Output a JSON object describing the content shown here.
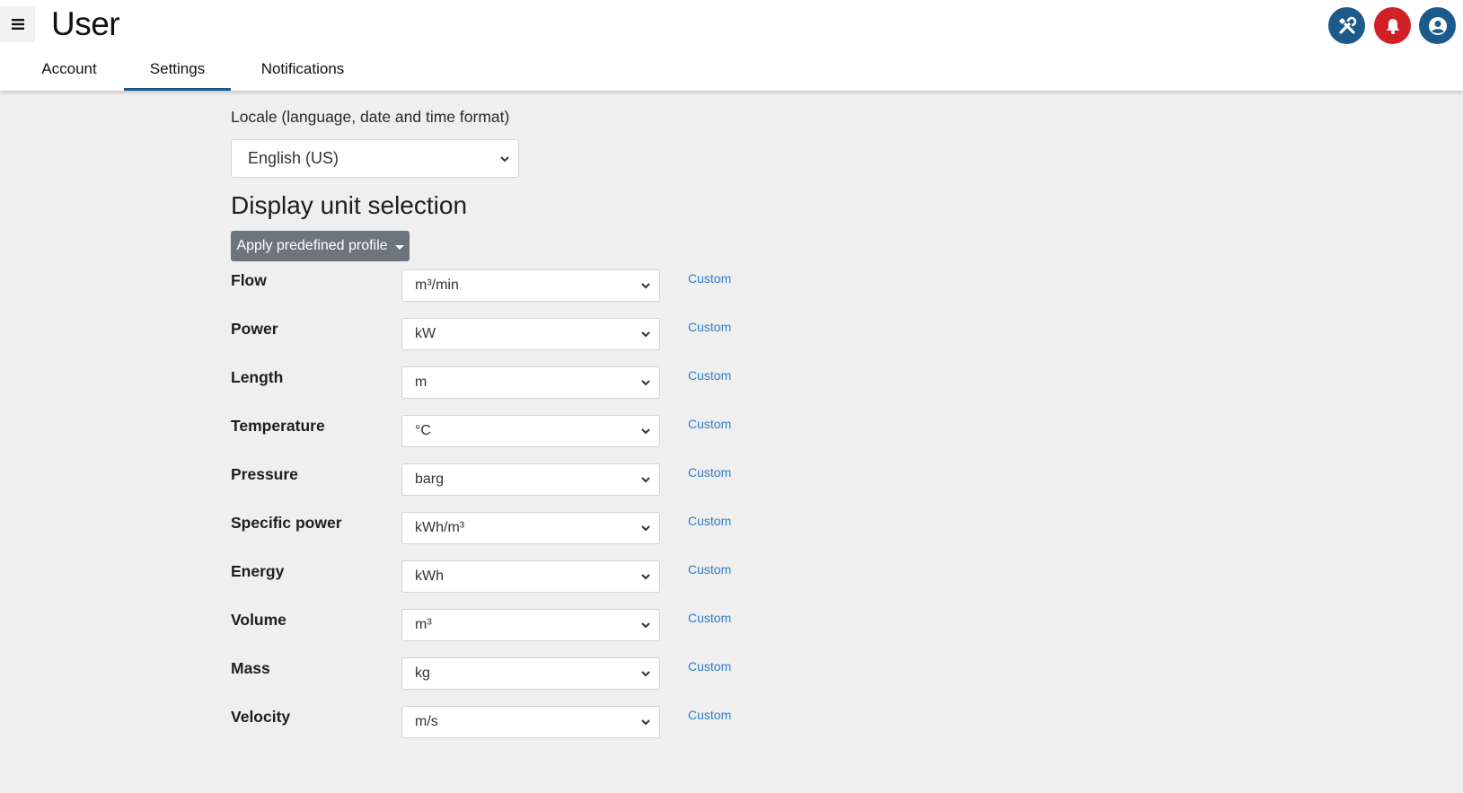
{
  "header": {
    "title": "User",
    "tabs": [
      {
        "label": "Account"
      },
      {
        "label": "Settings"
      },
      {
        "label": "Notifications"
      }
    ],
    "active_tab": "Settings",
    "icons": {
      "menu": "hamburger-icon",
      "tools": "tools-icon",
      "notifications": "bell-icon",
      "profile": "user-circle-icon"
    },
    "colors": {
      "tools_button": "#1b5a8a",
      "notifications_button": "#d32027",
      "profile_button": "#1b5a8a"
    }
  },
  "locale": {
    "label": "Locale (language, date and time format)",
    "selected": "English (US)"
  },
  "units": {
    "title": "Display unit selection",
    "profile_button_label": "Apply predefined profile",
    "custom_label": "Custom",
    "rows": [
      {
        "label": "Flow",
        "value": "m³/min"
      },
      {
        "label": "Power",
        "value": "kW"
      },
      {
        "label": "Length",
        "value": "m"
      },
      {
        "label": "Temperature",
        "value": "°C"
      },
      {
        "label": "Pressure",
        "value": "barg"
      },
      {
        "label": "Specific power",
        "value": "kWh/m³"
      },
      {
        "label": "Energy",
        "value": "kWh"
      },
      {
        "label": "Volume",
        "value": "m³"
      },
      {
        "label": "Mass",
        "value": "kg"
      },
      {
        "label": "Velocity",
        "value": "m/s"
      }
    ]
  }
}
